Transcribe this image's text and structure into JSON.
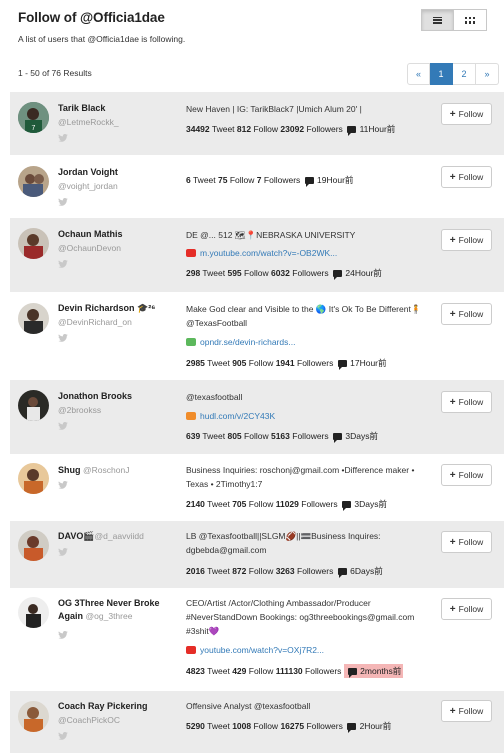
{
  "header": {
    "title": "Follow of @Officia1dae",
    "subtitle": "A list of users that @Officia1dae is following."
  },
  "view_toggle": {
    "list_icon": "list-icon",
    "grid_icon": "grid-icon",
    "active": "list"
  },
  "results_text": "1 - 50 of 76 Results",
  "pagination": {
    "prev": "«",
    "pages": [
      "1",
      "2"
    ],
    "active": "1",
    "next": "»"
  },
  "follow_label": "Follow",
  "users": [
    {
      "name": "Tarik Black",
      "handle": "@LetmeRockk_",
      "desc": "New Haven | IG: TarikBlack7 |Umich Alum 20' |",
      "tweets": "34492",
      "following": "812",
      "followers": "23092",
      "time": "11Hour前",
      "avatar_color": "#5a7a6a"
    },
    {
      "name": "Jordan Voight",
      "handle": "@voight_jordan",
      "desc": "",
      "tweets": "6",
      "following": "75",
      "followers": "7",
      "time": "19Hour前",
      "avatar_color": "#7a5c4a"
    },
    {
      "name": "Ochaun Mathis",
      "handle": "@OchaunDevon",
      "desc": "DE @... 512 🗺📍NEBRASKA UNIVERSITY",
      "link": "m.youtube.com/watch?v=-OB2WK...",
      "link_icon": "youtube-icon",
      "tweets": "298",
      "following": "595",
      "followers": "6032",
      "time": "24Hour前",
      "avatar_color": "#8a3a32"
    },
    {
      "name": "Devin Richardson 🎓²⁶",
      "handle": "@DevinRichard_on",
      "desc": "Make God clear and Visible to the 🌎 It's Ok To Be Different🧍 @TexasFootball",
      "link": "opndr.se/devin-richards...",
      "link_icon": "chart-icon",
      "tweets": "2985",
      "following": "905",
      "followers": "1941",
      "time": "17Hour前",
      "avatar_color": "#5a4a3a"
    },
    {
      "name": "Jonathon Brooks",
      "handle": "@2brookss",
      "desc": "@texasfootball",
      "link": "hudl.com/v/2CY43K",
      "link_icon": "hudl-icon",
      "tweets": "639",
      "following": "805",
      "followers": "5163",
      "time": "3Days前",
      "avatar_color": "#3a3a32"
    },
    {
      "name": "Shug",
      "handle": "@RoschonJ",
      "desc": "Business Inquiries: roschonj@gmail.com •Difference maker • Texas • 2Timothy1:7",
      "tweets": "2140",
      "following": "705",
      "followers": "11029",
      "time": "3Days前",
      "avatar_color": "#b5733a"
    },
    {
      "name": "DAVO🎬",
      "handle": "@d_aavviidd",
      "desc": "LB @Texasfootball||SLGM🏈||🟰Business Inquires: dgbebda@gmail.com",
      "tweets": "2016",
      "following": "872",
      "followers": "3263",
      "time": "6Days前",
      "avatar_color": "#a4553a"
    },
    {
      "name": "OG 3Three Never Broke Again",
      "handle": "@og_3three",
      "desc": "CEO/Artist /Actor/Clothing Ambassador/Producer #NeverStandDown Bookings: og3threebookings@gmail.com #3shit💜",
      "link": "youtube.com/watch?v=OXj7R2...",
      "link_icon": "youtube-icon",
      "tweets": "4823",
      "following": "429",
      "followers": "111130",
      "time": "2months前",
      "time_highlight": "#f4b6b6",
      "avatar_color": "#444444"
    },
    {
      "name": "Coach Ray Pickering",
      "handle": "@CoachPickOC",
      "desc": "Offensive Analyst @texasfootball",
      "tweets": "5290",
      "following": "1008",
      "followers": "16275",
      "time": "2Hour前",
      "avatar_color": "#b06a2a"
    }
  ],
  "labels": {
    "tweet": "Tweet",
    "follow": "Follow",
    "followers": "Followers"
  },
  "colors": {
    "link": "#337ab7",
    "row_alt": "#ebebeb",
    "youtube": "#e52d27",
    "twitter": "#c9c9c9"
  }
}
